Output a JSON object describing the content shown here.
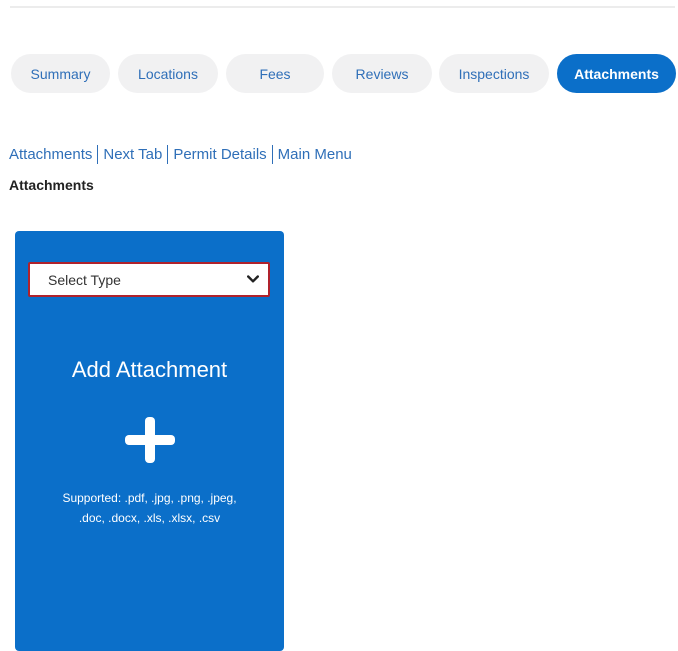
{
  "tabs": [
    {
      "label": "Summary"
    },
    {
      "label": "Locations"
    },
    {
      "label": "Fees"
    },
    {
      "label": "Reviews"
    },
    {
      "label": "Inspections"
    },
    {
      "label": "Attachments"
    }
  ],
  "links": {
    "attachments": "Attachments",
    "next_tab": "Next Tab",
    "permit_details": "Permit Details",
    "main_menu": "Main Menu"
  },
  "section_title": "Attachments",
  "card": {
    "select_value": "Select Type",
    "title": "Add Attachment",
    "supported_line1": "Supported: .pdf, .jpg, .png, .jpeg,",
    "supported_line2": ".doc, .docx, .xls, .xlsx, .csv"
  },
  "colors": {
    "accent": "#0b6fc9",
    "tab_bg": "#f1f1f2",
    "link": "#2f6fb8",
    "select_border": "#b0222c"
  },
  "icons": {
    "select_chevron": "chevron-down-icon",
    "add": "plus-icon"
  }
}
